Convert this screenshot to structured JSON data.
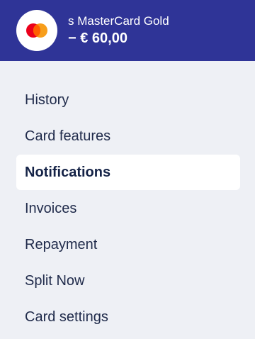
{
  "header": {
    "card_name": "s MasterCard Gold",
    "balance": "− € 60,00",
    "logo_icon": "mastercard-logo-icon",
    "colors": {
      "background": "#2f3497",
      "mc_red": "#eb001b",
      "mc_orange": "#f79e1b"
    }
  },
  "menu": {
    "active_index": 2,
    "items": [
      {
        "label": "History"
      },
      {
        "label": "Card features"
      },
      {
        "label": "Notifications"
      },
      {
        "label": "Invoices"
      },
      {
        "label": "Repayment"
      },
      {
        "label": "Split Now"
      },
      {
        "label": "Card settings"
      }
    ]
  }
}
